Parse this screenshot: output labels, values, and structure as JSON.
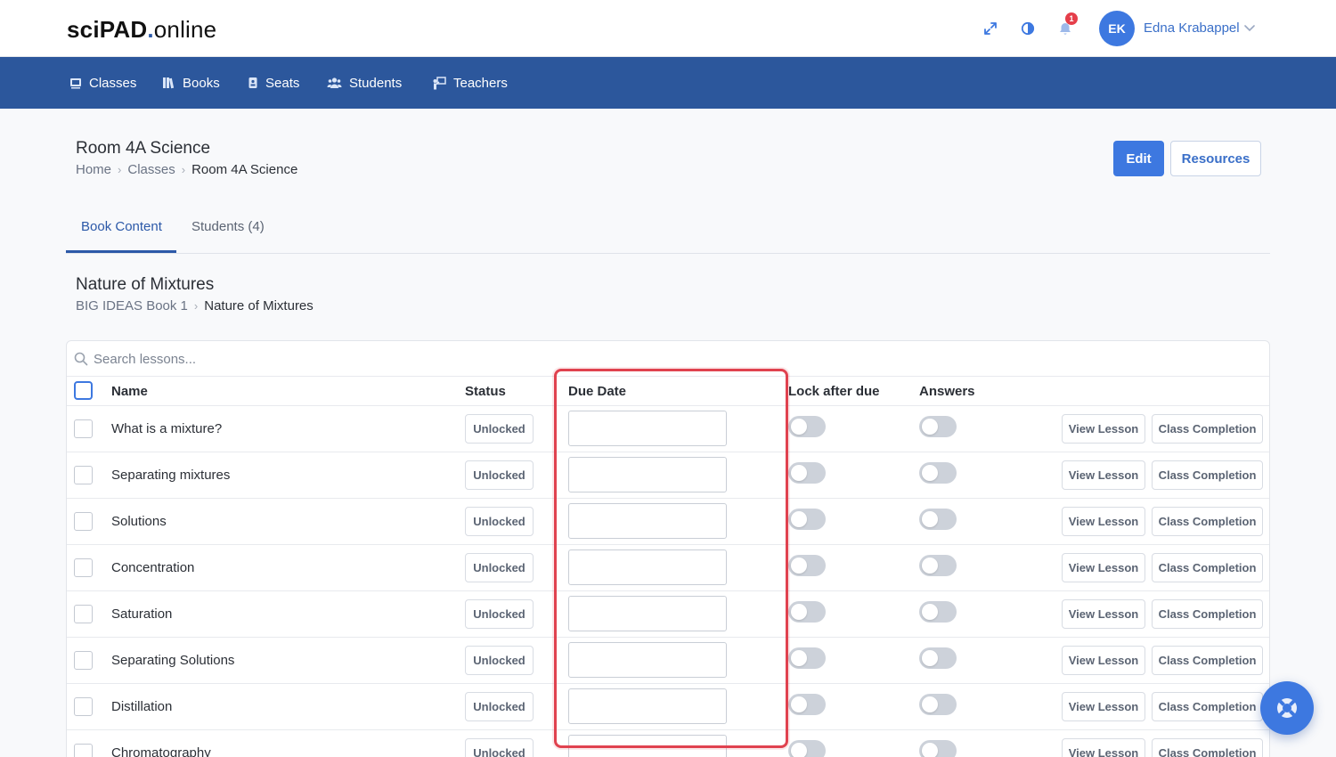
{
  "app": {
    "logo_brand": "sciPAD",
    "logo_dot": ".",
    "logo_suffix": "online"
  },
  "header": {
    "notification_count": "1",
    "user_initials": "EK",
    "user_name": "Edna Krabappel",
    "icons": [
      "expand-icon",
      "contrast-icon",
      "bell-icon",
      "chevron-down-icon"
    ]
  },
  "nav": {
    "items": [
      {
        "label": "Classes",
        "icon": "classes-icon"
      },
      {
        "label": "Books",
        "icon": "books-icon"
      },
      {
        "label": "Seats",
        "icon": "seats-icon"
      },
      {
        "label": "Students",
        "icon": "students-icon"
      },
      {
        "label": "Teachers",
        "icon": "teachers-icon"
      }
    ]
  },
  "page": {
    "title": "Room 4A Science",
    "breadcrumb": [
      "Home",
      "Classes",
      "Room 4A Science"
    ],
    "edit_label": "Edit",
    "resources_label": "Resources"
  },
  "tabs": [
    {
      "label": "Book Content",
      "active": true
    },
    {
      "label": "Students (4)",
      "active": false
    }
  ],
  "section": {
    "title": "Nature of Mixtures",
    "breadcrumb": [
      "BIG IDEAS Book 1",
      "Nature of Mixtures"
    ]
  },
  "table": {
    "search_placeholder": "Search lessons...",
    "columns": {
      "name": "Name",
      "status": "Status",
      "due_date": "Due Date",
      "lock_after_due": "Lock after due",
      "answers": "Answers"
    },
    "view_label": "View Lesson",
    "completion_label": "Class Completion",
    "rows": [
      {
        "name": "What is a mixture?",
        "status": "Unlocked",
        "due_date": "",
        "lock_after_due": false,
        "answers": false
      },
      {
        "name": "Separating mixtures",
        "status": "Unlocked",
        "due_date": "",
        "lock_after_due": false,
        "answers": false
      },
      {
        "name": "Solutions",
        "status": "Unlocked",
        "due_date": "",
        "lock_after_due": false,
        "answers": false
      },
      {
        "name": "Concentration",
        "status": "Unlocked",
        "due_date": "",
        "lock_after_due": false,
        "answers": false
      },
      {
        "name": "Saturation",
        "status": "Unlocked",
        "due_date": "",
        "lock_after_due": false,
        "answers": false
      },
      {
        "name": "Separating Solutions",
        "status": "Unlocked",
        "due_date": "",
        "lock_after_due": false,
        "answers": false
      },
      {
        "name": "Distillation",
        "status": "Unlocked",
        "due_date": "",
        "lock_after_due": false,
        "answers": false
      },
      {
        "name": "Chromatography",
        "status": "Unlocked",
        "due_date": "",
        "lock_after_due": false,
        "answers": false
      }
    ]
  },
  "colors": {
    "navbar": "#2c579c",
    "accent": "#3d78e0",
    "highlight": "#e0424f",
    "badge": "#e53e4a"
  }
}
